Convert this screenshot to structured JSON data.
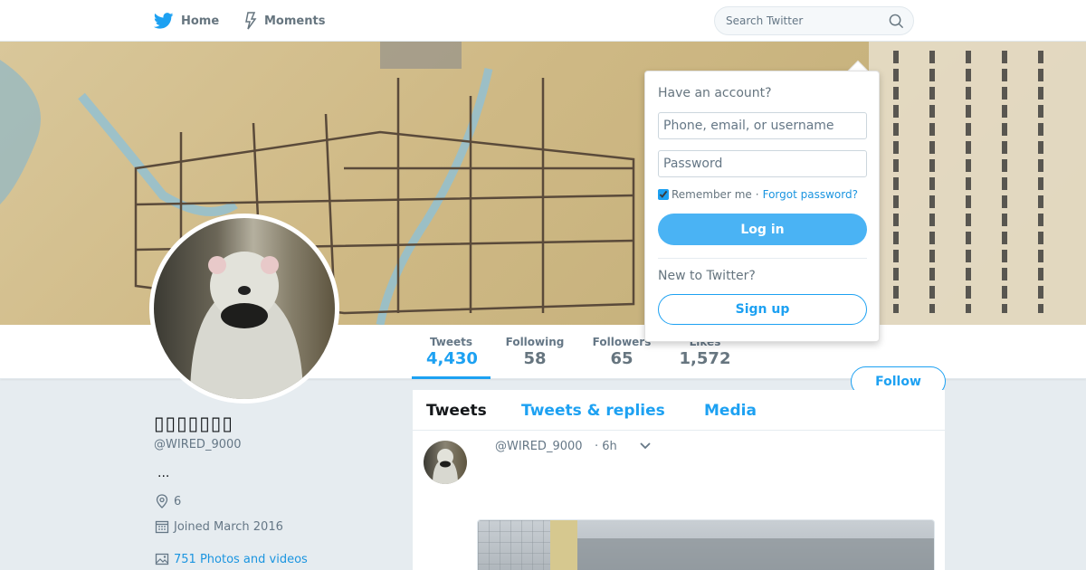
{
  "nav": {
    "home_label": "Home",
    "moments_label": "Moments",
    "search_placeholder": "Search Twitter"
  },
  "banner": {
    "login_link_text": "Have an account? Log in ▾"
  },
  "stats": {
    "tweets": {
      "label": "Tweets",
      "value": "4,430"
    },
    "following": {
      "label": "Following",
      "value": "58"
    },
    "followers": {
      "label": "Followers",
      "value": "65"
    },
    "likes": {
      "label": "Likes",
      "value": "1,572"
    }
  },
  "follow_label": "Follow",
  "profile": {
    "name": "▯▯▯▯▯▯▯",
    "handle": "@WIRED_9000",
    "bio": "...",
    "location": "6",
    "joined": "Joined March 2016",
    "photos": "751 Photos and videos"
  },
  "timeline": {
    "tabs": [
      {
        "label": "Tweets"
      },
      {
        "label": "Tweets & replies"
      },
      {
        "label": "Media"
      }
    ],
    "tweet": {
      "handle": "@WIRED_9000",
      "time": "· 6h"
    }
  },
  "login": {
    "title": "Have an account?",
    "username_placeholder": "Phone, email, or username",
    "password_placeholder": "Password",
    "remember_label": "Remember me",
    "separator": "·",
    "forgot_label": "Forgot password?",
    "login_button": "Log in",
    "new_label": "New to Twitter?",
    "signup_button": "Sign up"
  },
  "colors": {
    "accent": "#1da1f2",
    "login_button": "#4ab3f4",
    "page_background": "#e6ecf0"
  },
  "icons": [
    "twitter-bird-icon",
    "moments-lightning-icon",
    "search-icon",
    "location-pin-icon",
    "calendar-icon",
    "photo-icon",
    "chevron-down-icon"
  ]
}
